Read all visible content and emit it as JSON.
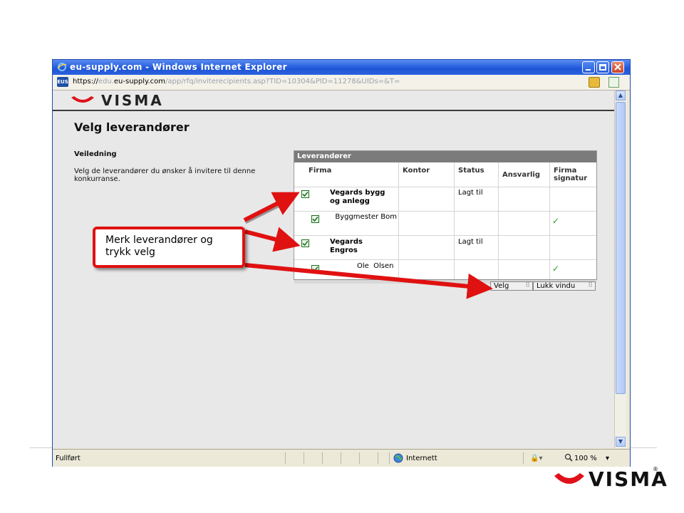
{
  "browser": {
    "title": "eu-supply.com - Windows Internet Explorer",
    "address": {
      "scheme": "https://",
      "host_pre": "edu.",
      "host": "eu-supply.com",
      "path": "/app/rfq/inviterecipients.asp?TID=10304&PID=11278&UIDs=&T=",
      "site_icon_text": "EUS"
    },
    "status": {
      "text": "Fullført",
      "zone": "Internett",
      "zoom": "100 %"
    }
  },
  "header": {
    "brand": "VISMA"
  },
  "page": {
    "title": "Velg leverandører",
    "guide_title": "Veiledning",
    "guide_text": "Velg de leverandører du ønsker å invitere til denne konkurranse."
  },
  "grid": {
    "title": "Leverandører",
    "columns": [
      "Firma",
      "Kontor",
      "Status",
      "Ansvarlig",
      "Firma signatur"
    ],
    "rows": [
      {
        "firma": "Vegards bygg og anlegg",
        "status": "Lagt til",
        "checked": true,
        "signed": false
      },
      {
        "firma": "Byggmester Bom",
        "status": "",
        "checked": true,
        "signed": true
      },
      {
        "firma": "Vegards Engros",
        "status": "Lagt til",
        "checked": true,
        "signed": false
      },
      {
        "firma": "Ole  Olsen",
        "status": "",
        "checked": true,
        "signed": true
      }
    ],
    "buttons": {
      "select": "Velg",
      "close": "Lukk vindu"
    }
  },
  "callout": {
    "text": "Merk leverandører og trykk velg",
    "color": "#e01111"
  },
  "colors": {
    "titlebar": "#2b62e0",
    "grid_header": "#7b7b7b",
    "visma_red": "#e0111a",
    "check_green": "#2aa12a"
  },
  "footer": {
    "brand": "VISMA"
  }
}
